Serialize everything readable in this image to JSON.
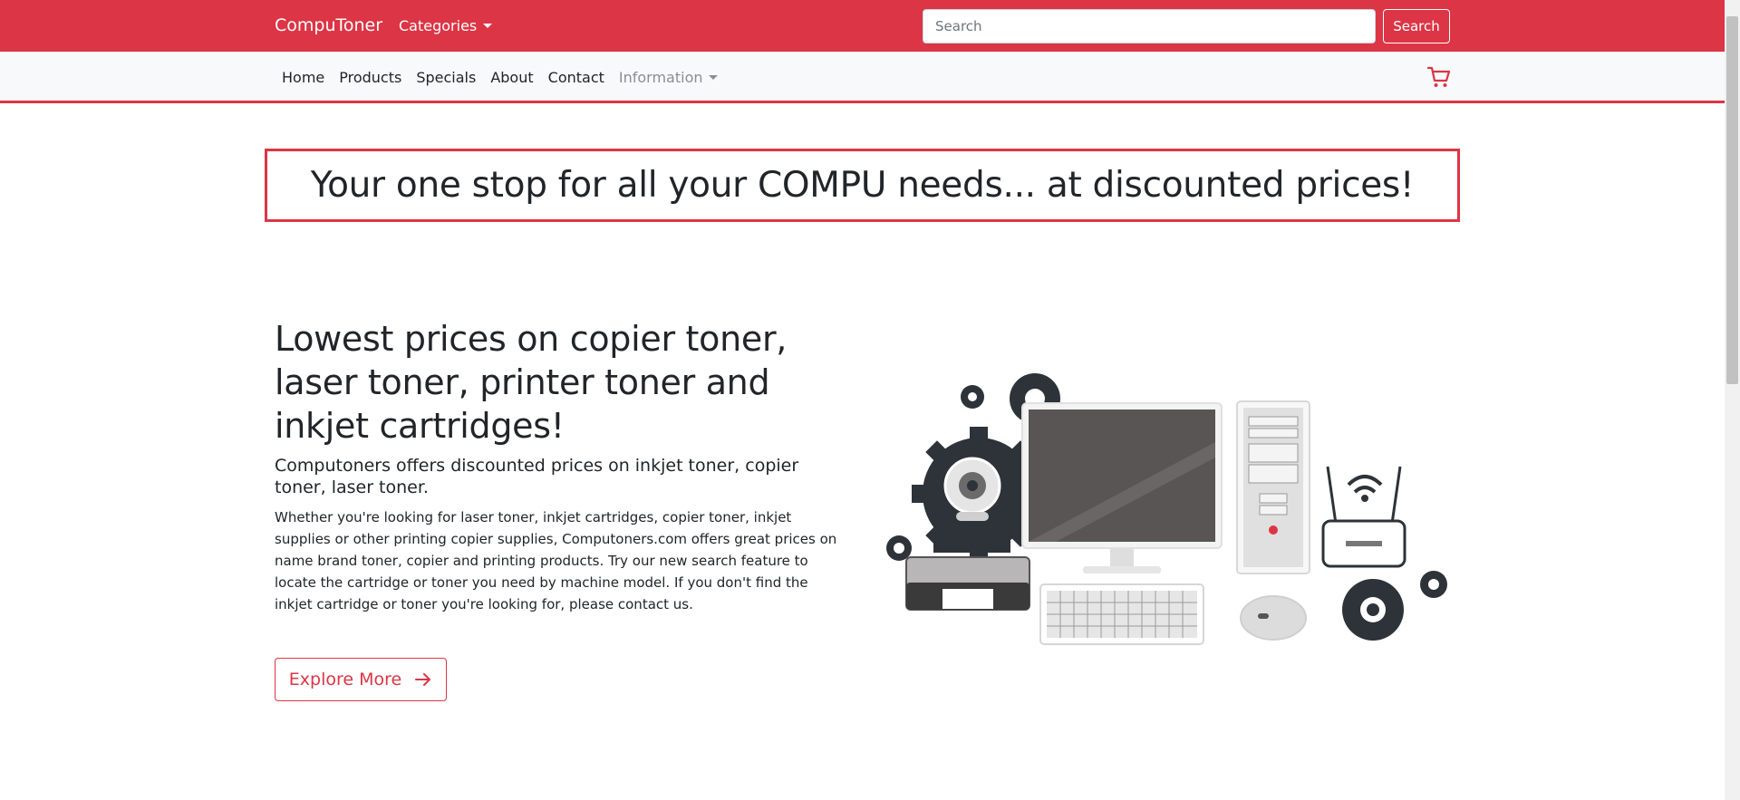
{
  "header": {
    "brand": "CompuToner",
    "categories_label": "Categories",
    "search_placeholder": "Search",
    "search_button": "Search"
  },
  "nav": {
    "items": [
      "Home",
      "Products",
      "Specials",
      "About",
      "Contact"
    ],
    "information_label": "Information",
    "cart_icon": "cart-icon"
  },
  "banner": {
    "text": "Your one stop for all your COMPU needs... at discounted prices!"
  },
  "hero": {
    "title": "Lowest prices on copier toner, laser toner, printer toner and inkjet cartridges!",
    "subtitle": "Computoners offers discounted prices on inkjet toner, copier toner, laser toner.",
    "body": "Whether you're looking for laser toner, inkjet cartridges, copier toner, inkjet supplies or other printing copier supplies, Computoners.com offers great prices on name brand toner, copier and printing products. Try our new search feature to locate the cartridge or toner you need by machine model. If you don't find the inkjet cartridge or toner you're looking for, please contact us.",
    "button_label": "Explore More"
  },
  "colors": {
    "accent": "#dc3545",
    "nav_bg": "#f8f9fa",
    "text": "#212529",
    "illustration_dark": "#2d3338"
  }
}
